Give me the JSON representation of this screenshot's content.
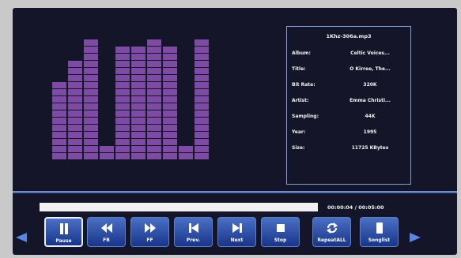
{
  "visualizer": {
    "bar_heights": [
      11,
      14,
      17,
      2,
      16,
      16,
      17,
      16,
      2,
      17
    ],
    "max_level": 17,
    "color": "#7d4ba3"
  },
  "info": {
    "file": "1Khz-306a.mp3",
    "rows": [
      {
        "key": "Album:",
        "value": "Celtic Voices..."
      },
      {
        "key": "Title:",
        "value": "O Kirree, The..."
      },
      {
        "key": "Bit Rate:",
        "value": "320K"
      },
      {
        "key": "Artist:",
        "value": "Emma Christi..."
      },
      {
        "key": "Sampling:",
        "value": "44K"
      },
      {
        "key": "Year:",
        "value": "1995"
      },
      {
        "key": "Size:",
        "value": "11725 KBytes"
      }
    ]
  },
  "progress": {
    "fraction": 0.02,
    "time_text": "00:00:04 / 00:05:00"
  },
  "controls": {
    "pause": {
      "label": "Pause",
      "icon": "pause-icon"
    },
    "fb": {
      "label": "FB",
      "icon": "fast-backward-icon"
    },
    "ff": {
      "label": "FF",
      "icon": "fast-forward-icon"
    },
    "prev": {
      "label": "Prev.",
      "icon": "previous-track-icon"
    },
    "next": {
      "label": "Next",
      "icon": "next-track-icon"
    },
    "stop": {
      "label": "Stop",
      "icon": "stop-icon"
    },
    "repeat": {
      "label": "RepeatALL",
      "icon": "repeat-icon"
    },
    "songlist": {
      "label": "Songlist",
      "icon": "songlist-icon"
    }
  },
  "colors": {
    "accent": "#3f62b5",
    "screen_bg": "#141529"
  }
}
